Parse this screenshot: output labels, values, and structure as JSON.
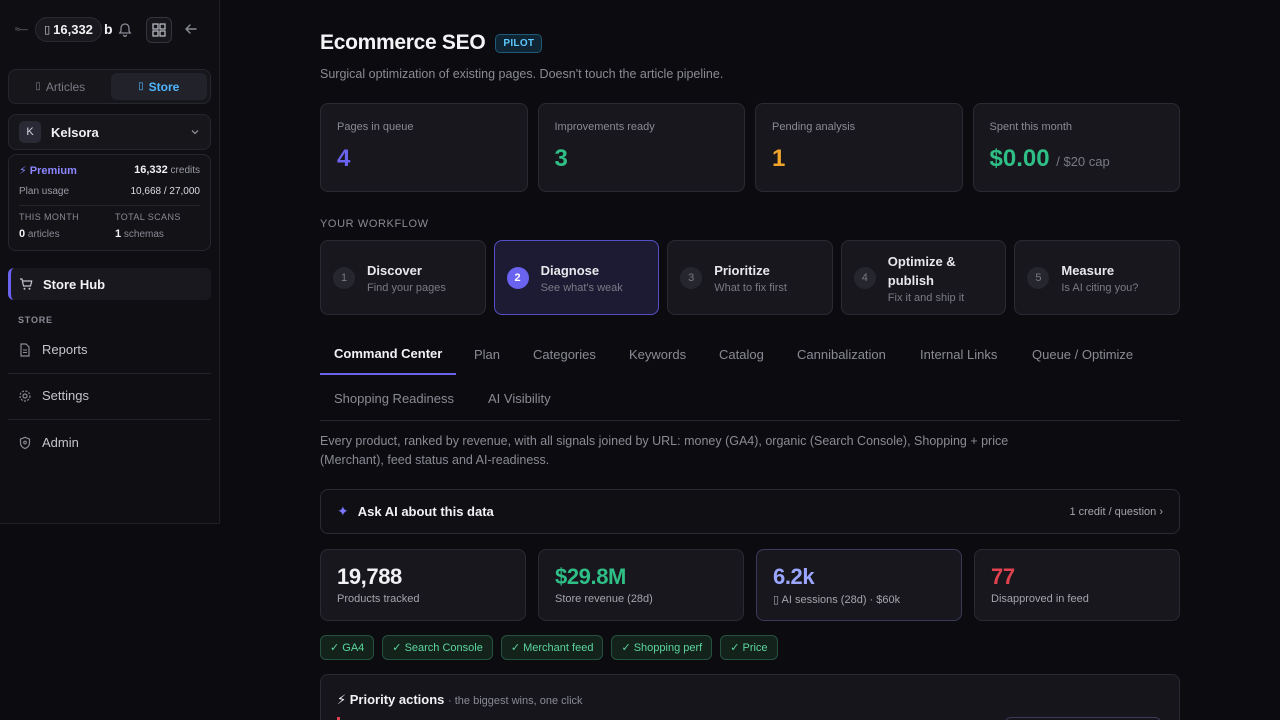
{
  "topbar": {
    "logo_text": "≈—",
    "credits": "16,332",
    "credits_icon": "▯",
    "letter": "b",
    "icons": [
      "bell-icon",
      "grid-icon",
      "arrow-left-icon"
    ]
  },
  "mode_switch": [
    {
      "label": "Articles",
      "icon": "▯",
      "active": false
    },
    {
      "label": "Store",
      "icon": "▯",
      "active": true
    }
  ],
  "store": {
    "avatar": "K",
    "name": "Kelsora"
  },
  "plan": {
    "tier": "⚡ Premium",
    "credits_value": "16,332",
    "credits_unit": "credits",
    "usage_label": "Plan usage",
    "usage_value": "10,668 / 27,000",
    "this_month_label": "THIS MONTH",
    "this_month_value": "0",
    "this_month_unit": "articles",
    "total_scans_label": "TOTAL SCANS",
    "total_scans_value": "1",
    "total_scans_unit": "schemas"
  },
  "nav": {
    "active": "Store Hub",
    "section": "STORE",
    "items": [
      "Reports",
      "Settings",
      "Admin"
    ]
  },
  "header": {
    "title": "Ecommerce SEO",
    "badge": "PILOT",
    "subtitle": "Surgical optimization of existing pages. Doesn't touch the article pipeline."
  },
  "stats": [
    {
      "label": "Pages in queue",
      "value": "4",
      "color": "#6a63f0"
    },
    {
      "label": "Improvements ready",
      "value": "3",
      "color": "#2fbf86"
    },
    {
      "label": "Pending analysis",
      "value": "1",
      "color": "#f0a52a"
    },
    {
      "label": "Spent this month",
      "value": "$0.00",
      "sub": "/ $20 cap",
      "color": "#2fbf86"
    }
  ],
  "workflow": {
    "heading": "YOUR WORKFLOW",
    "steps": [
      {
        "num": "1",
        "title": "Discover",
        "sub": "Find your pages",
        "active": false
      },
      {
        "num": "2",
        "title": "Diagnose",
        "sub": "See what's weak",
        "active": true
      },
      {
        "num": "3",
        "title": "Prioritize",
        "sub": "What to fix first",
        "active": false
      },
      {
        "num": "4",
        "title": "Optimize & publish",
        "sub": "Fix it and ship it",
        "active": false
      },
      {
        "num": "5",
        "title": "Measure",
        "sub": "Is AI citing you?",
        "active": false
      }
    ]
  },
  "tabs": [
    "Command Center",
    "Plan",
    "Categories",
    "Keywords",
    "Catalog",
    "Cannibalization",
    "Internal Links",
    "Queue / Optimize",
    "Shopping Readiness",
    "AI Visibility"
  ],
  "description": "Every product, ranked by revenue, with all signals joined by URL: money (GA4), organic (Search Console), Shopping + price (Merchant), feed status and AI-readiness.",
  "ask_ai": {
    "icon": "✦",
    "label": "Ask AI about this data",
    "cost": "1 credit / question ›"
  },
  "kpis": [
    {
      "value": "19,788",
      "label": "Products tracked",
      "color": "#f2f2f4"
    },
    {
      "value": "$29.8M",
      "label": "Store revenue (28d)",
      "color": "#2fbf86"
    },
    {
      "value": "6.2k",
      "label": "▯ AI sessions (28d) · $60k",
      "color": "#9aa6ff"
    },
    {
      "value": "77",
      "label": "Disapproved in feed",
      "color": "#e0434f"
    }
  ],
  "sources": [
    "✓ GA4",
    "✓ Search Console",
    "✓ Merchant feed",
    "✓ Shopping perf",
    "✓ Price"
  ],
  "priority": {
    "title": "⚡ Priority actions",
    "sub": "· the biggest wins, one click"
  }
}
